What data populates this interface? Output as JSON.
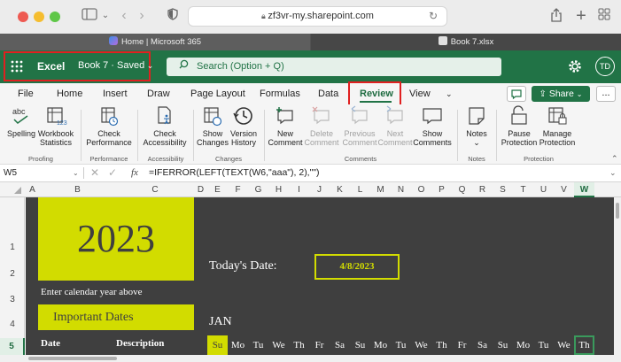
{
  "browser": {
    "url": "zf3vr-my.sharepoint.com",
    "tabs": [
      {
        "title": "Home | Microsoft 365"
      },
      {
        "title": "Book 7.xlsx"
      }
    ]
  },
  "excel": {
    "app_name": "Excel",
    "workbook": "Book 7 · Saved",
    "search_placeholder": "Search (Option + Q)",
    "avatar": "TD",
    "accent": "#217346"
  },
  "menu": {
    "items": [
      "File",
      "Home",
      "Insert",
      "Draw",
      "Page Layout",
      "Formulas",
      "Data",
      "Review",
      "View"
    ],
    "active": "Review",
    "share_label": "Share",
    "more_label": "..."
  },
  "ribbon": {
    "buttons": {
      "spelling": "Spelling",
      "workbook_stats": "Workbook Statistics",
      "check_perf": "Check Performance",
      "check_access": "Check Accessibility",
      "show_changes": "Show Changes",
      "version_history": "Version History",
      "new_comment": "New Comment",
      "delete_comment": "Delete Comment",
      "prev_comment": "Previous Comment",
      "next_comment": "Next Comment",
      "show_comments": "Show Comments",
      "notes": "Notes",
      "pause_protection": "Pause Protection",
      "manage_protection": "Manage Protection"
    },
    "groups": {
      "proofing": "Proofing",
      "performance": "Performance",
      "accessibility": "Accessibility",
      "changes": "Changes",
      "comments": "Comments",
      "notes": "Notes",
      "protection": "Protection"
    }
  },
  "formula_bar": {
    "cell_ref": "W5",
    "fx": "fx",
    "formula": "=IFERROR(LEFT(TEXT(W6,\"aaa\"), 2),\"\")"
  },
  "columns": [
    "A",
    "B",
    "C",
    "D",
    "E",
    "F",
    "G",
    "H",
    "I",
    "J",
    "K",
    "L",
    "M",
    "N",
    "O",
    "P",
    "Q",
    "R",
    "S",
    "T",
    "U",
    "V",
    "W"
  ],
  "rows": [
    "1",
    "2",
    "3",
    "4",
    "5"
  ],
  "sheet": {
    "year": "2023",
    "todays_date_label": "Today's Date:",
    "todays_date": "4/8/2023",
    "instruction": "Enter calendar year above",
    "important_dates": "Important Dates",
    "month": "JAN",
    "date_header": "Date",
    "description_header": "Description",
    "days": [
      "Su",
      "Mo",
      "Tu",
      "We",
      "Th",
      "Fr",
      "Sa",
      "Su",
      "Mo",
      "Tu",
      "We",
      "Th",
      "Fr",
      "Sa",
      "Su",
      "Mo",
      "Tu",
      "We",
      "Th"
    ],
    "highlight_color": "#d2dc00",
    "background": "#3f3f3f"
  }
}
